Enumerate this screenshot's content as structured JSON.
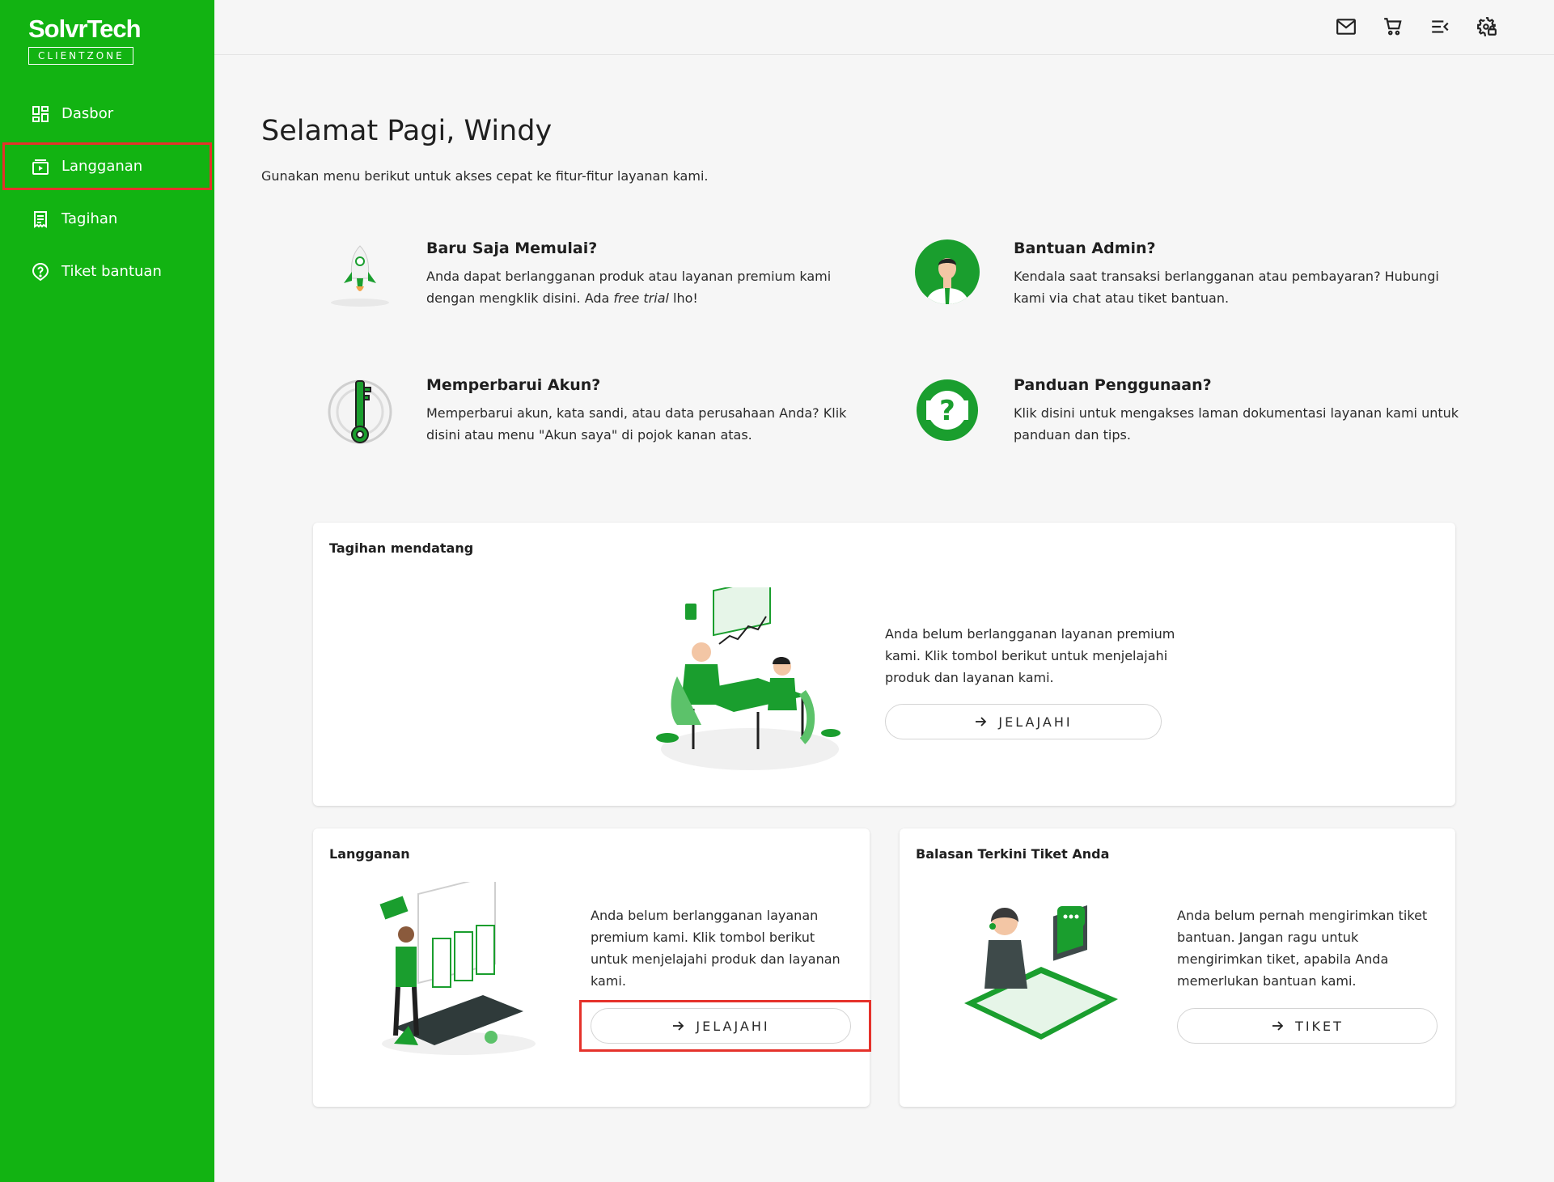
{
  "brand": {
    "name": "SolvrTech",
    "sub": "CLIENTZONE"
  },
  "sidebar": {
    "items": [
      {
        "label": "Dasbor",
        "icon": "dashboard-icon"
      },
      {
        "label": "Langganan",
        "icon": "subscription-icon",
        "active": true
      },
      {
        "label": "Tagihan",
        "icon": "invoice-icon"
      },
      {
        "label": "Tiket bantuan",
        "icon": "help-icon"
      }
    ]
  },
  "header": {
    "icons": [
      "mail-icon",
      "cart-icon",
      "menu-collapse-icon",
      "settings-lock-icon"
    ]
  },
  "main": {
    "greeting": "Selamat Pagi, Windy",
    "subtitle": "Gunakan menu berikut untuk akses cepat ke fitur-fitur layanan kami.",
    "quick": [
      {
        "title": "Baru Saja Memulai?",
        "text_before": "Anda dapat berlangganan produk atau layanan premium kami dengan mengklik disini. Ada ",
        "text_em": "free trial",
        "text_after": " lho!",
        "icon": "rocket-icon"
      },
      {
        "title": "Bantuan Admin?",
        "text": "Kendala saat transaksi berlangganan atau pembayaran? Hubungi kami via chat atau tiket bantuan.",
        "icon": "admin-avatar-icon"
      },
      {
        "title": "Memperbarui Akun?",
        "text": "Memperbarui akun, kata sandi, atau data perusahaan Anda? Klik disini atau menu \"Akun saya\" di pojok kanan atas.",
        "icon": "key-icon"
      },
      {
        "title": "Panduan Penggunaan?",
        "text": "Klik disini untuk mengakses laman dokumentasi layanan kami untuk panduan dan tips.",
        "icon": "lifebuoy-icon"
      }
    ],
    "invoice_card": {
      "title": "Tagihan mendatang",
      "text": "Anda belum berlangganan layanan premium kami. Klik tombol berikut untuk menjelajahi produk dan layanan kami.",
      "button": "JELAJAHI"
    },
    "subscription_card": {
      "title": "Langganan",
      "text": "Anda belum berlangganan layanan premium kami. Klik tombol berikut untuk menjelajahi produk dan layanan kami.",
      "button": "JELAJAHI"
    },
    "ticket_card": {
      "title": "Balasan Terkini Tiket Anda",
      "text": "Anda belum pernah mengirimkan tiket bantuan. Jangan ragu untuk mengirimkan tiket, apabila Anda memerlukan bantuan kami.",
      "button": "TIKET"
    }
  },
  "colors": {
    "sidebar": "#12b312",
    "accent": "#1a9e2e",
    "highlight": "#e5322b"
  }
}
